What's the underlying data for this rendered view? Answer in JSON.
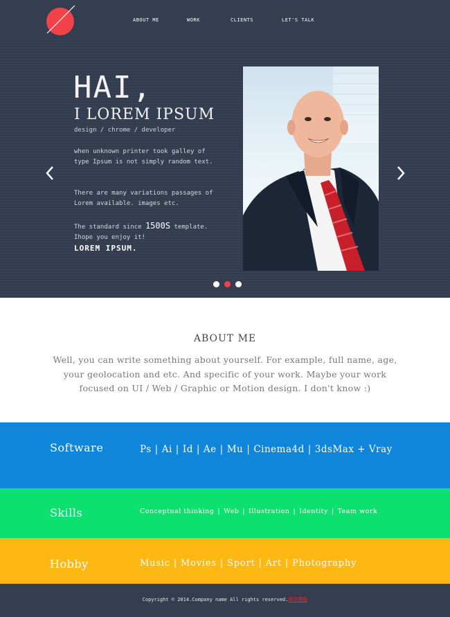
{
  "nav": {
    "items": [
      "ABOUT ME",
      "WORK",
      "CLIENTS",
      "LET'S TALK"
    ]
  },
  "hero": {
    "title": "HAI,",
    "subtitle": "I LOREM IPSUM",
    "tagline": "design / chrome / developer",
    "para1": "when unknown printer took galley of type Ipsum is not simply random text.",
    "para2": "There are many variations passages of Lorem available. images etc.",
    "para3_a": "The standard since ",
    "para3_b": "1500S",
    "para3_c": " template. Ihope you enjoy it!",
    "para3_d": "LOREM IPSUM.",
    "prev_icon": "chevron-left-icon",
    "next_icon": "chevron-right-icon",
    "active_slide": 2,
    "slide_count": 3
  },
  "about": {
    "title": "ABOUT ME",
    "text": "Well, you can write something about yourself. For example, full name, age, your geolocation and etc. And specific of your work. Maybe your work focused on UI / Web / Graphic or Motion design. I don't know :)"
  },
  "software": {
    "label": "Software",
    "items": [
      "Ps",
      "Ai",
      "Id",
      "Ae",
      "Mu",
      "Cinema4d",
      "3dsMax + Vray"
    ]
  },
  "skills": {
    "label": "Skills",
    "items": [
      "Conceptual thinking",
      "Web",
      "Illustration",
      "Identity",
      "Team work"
    ]
  },
  "hobby": {
    "label": "Hobby",
    "items": [
      "Music",
      "Movies",
      "Sport",
      "Art",
      "Photography"
    ]
  },
  "footer": {
    "text": "Copyright © 2014.Company name All rights reserved.",
    "link": "网页模板"
  },
  "colors": {
    "dark": "#353d50",
    "accent": "#f2424a",
    "software": "#0f86d9",
    "skills": "#0ce06e",
    "hobby": "#fdb814"
  }
}
